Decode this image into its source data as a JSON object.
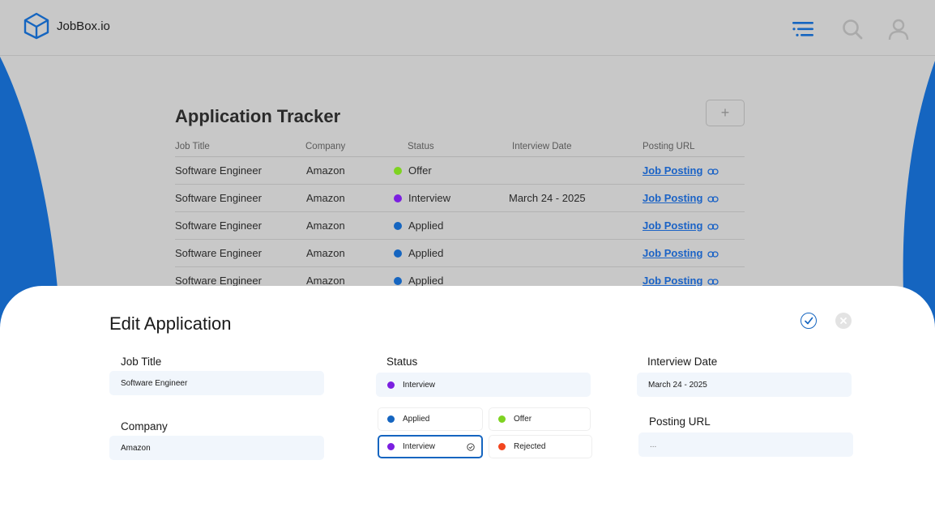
{
  "app": {
    "name": "JobBox.io",
    "logo_icon": "cube-logo-icon"
  },
  "header": {
    "icons": [
      "list-menu-icon",
      "search-icon",
      "user-icon"
    ]
  },
  "colors": {
    "accent": "#1565C0",
    "offer": "#7ED321",
    "interview": "#7B1FE0",
    "applied": "#1565C0",
    "rejected": "#F2451E",
    "background_dim": "#C8C8C8"
  },
  "tracker": {
    "title": "Application Tracker",
    "add_label": "+",
    "columns": [
      "Job Title",
      "Company",
      "Status",
      "Interview Date",
      "Posting URL"
    ],
    "rows": [
      {
        "title": "Software Engineer",
        "company": "Amazon",
        "status": "Offer",
        "status_color": "#7ED321",
        "interview_date": "",
        "url": "Job Posting"
      },
      {
        "title": "Software Engineer",
        "company": "Amazon",
        "status": "Interview",
        "status_color": "#7B1FE0",
        "interview_date": "March 24 - 2025",
        "url": "Job Posting"
      },
      {
        "title": "Software Engineer",
        "company": "Amazon",
        "status": "Applied",
        "status_color": "#1565C0",
        "interview_date": "",
        "url": "Job Posting"
      },
      {
        "title": "Software Engineer",
        "company": "Amazon",
        "status": "Applied",
        "status_color": "#1565C0",
        "interview_date": "",
        "url": "Job Posting"
      },
      {
        "title": "Software Engineer",
        "company": "Amazon",
        "status": "Applied",
        "status_color": "#1565C0",
        "interview_date": "",
        "url": "Job Posting"
      }
    ]
  },
  "edit": {
    "title": "Edit Application",
    "job_title": {
      "label": "Job Title",
      "value": "Software Engineer"
    },
    "company": {
      "label": "Company",
      "value": "Amazon"
    },
    "status": {
      "label": "Status",
      "value": "Interview",
      "value_color": "#7B1FE0",
      "options": [
        {
          "label": "Applied",
          "color": "#1565C0",
          "selected": false
        },
        {
          "label": "Offer",
          "color": "#7ED321",
          "selected": false
        },
        {
          "label": "Interview",
          "color": "#7B1FE0",
          "selected": true
        },
        {
          "label": "Rejected",
          "color": "#F2451E",
          "selected": false
        }
      ]
    },
    "interview_date": {
      "label": "Interview Date",
      "value": "March 24 - 2025"
    },
    "posting_url": {
      "label": "Posting URL",
      "value": "..."
    }
  }
}
